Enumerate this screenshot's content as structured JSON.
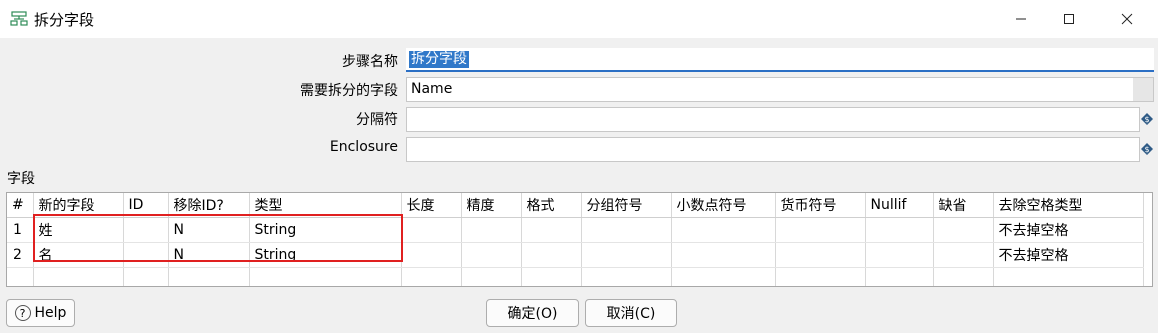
{
  "window": {
    "title": "拆分字段",
    "controls": {
      "minimize": "minimize-icon",
      "maximize": "maximize-icon",
      "close": "close-icon"
    }
  },
  "form": {
    "step_name_label": "步骤名称",
    "step_name_value": "拆分字段",
    "split_field_label": "需要拆分的字段",
    "split_field_value": "Name",
    "delimiter_label": "分隔符",
    "delimiter_value": "",
    "enclosure_label": "Enclosure",
    "enclosure_value": ""
  },
  "fields_section": {
    "label": "字段",
    "columns": [
      "#",
      "新的字段",
      "ID",
      "移除ID?",
      "类型",
      "长度",
      "精度",
      "格式",
      "分组符号",
      "小数点符号",
      "货币符号",
      "Nullif",
      "缺省",
      "去除空格类型"
    ],
    "rows": [
      [
        "1",
        "姓",
        "",
        "N",
        "String",
        "",
        "",
        "",
        "",
        "",
        "",
        "",
        "",
        "不去掉空格"
      ],
      [
        "2",
        "名",
        "",
        "N",
        "String",
        "",
        "",
        "",
        "",
        "",
        "",
        "",
        "",
        "不去掉空格"
      ]
    ]
  },
  "buttons": {
    "help": "Help",
    "ok": "确定(O)",
    "cancel": "取消(C)"
  },
  "colors": {
    "selection": "#3078c9",
    "highlight_box": "#e02020",
    "focus_underline": "#2b6fc4"
  }
}
